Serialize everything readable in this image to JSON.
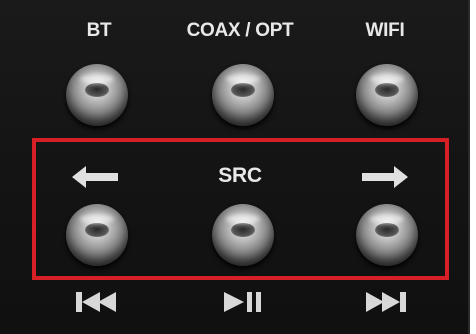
{
  "top_labels": {
    "bt": "BT",
    "coax_opt": "COAX / OPT",
    "wifi": "WIFI"
  },
  "src_label": "SRC",
  "icons": {
    "left": "left-arrow-icon",
    "right": "right-arrow-icon",
    "prev": "skip-previous-icon",
    "play_pause": "play-pause-icon",
    "next": "skip-next-icon"
  },
  "colors": {
    "panel": "#141414",
    "label": "#e8e8e8",
    "highlight_frame": "#d62026"
  }
}
